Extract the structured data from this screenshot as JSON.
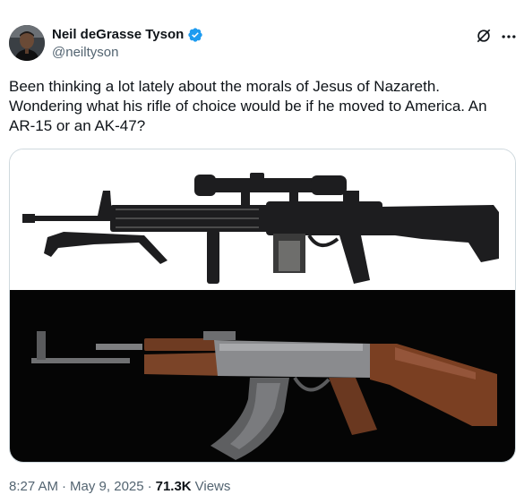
{
  "author": {
    "display_name": "Neil deGrasse Tyson",
    "handle": "@neiltyson",
    "verified": true
  },
  "tweet": {
    "text": "Been thinking a lot lately about the morals of Jesus of Nazareth. Wondering what his rifle of choice would be if he moved to America. An AR-15 or an AK-47?"
  },
  "media": {
    "images": [
      "ar15-rifle-photo",
      "ak47-rifle-photo"
    ]
  },
  "meta": {
    "time": "8:27 AM",
    "separator1": "·",
    "date": "May 9, 2025",
    "separator2": "·",
    "views_count": "71.3K",
    "views_label": "Views"
  },
  "icons": {
    "grok": "grok-icon",
    "more": "more-icon",
    "verified": "verified-badge-icon"
  },
  "colors": {
    "text_primary": "#0f1419",
    "text_secondary": "#536471",
    "verified_blue": "#1d9bf0",
    "border": "#cfd9de"
  }
}
